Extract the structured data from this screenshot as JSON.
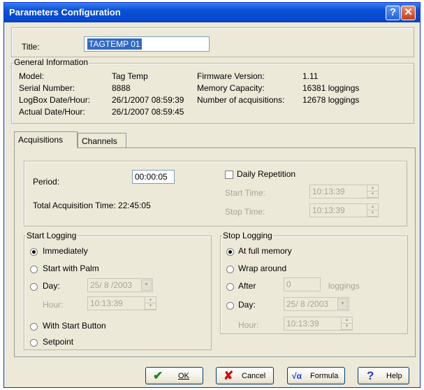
{
  "window": {
    "title": "Parameters Configuration",
    "help_glyph": "?",
    "close_glyph": "✕"
  },
  "title_field": {
    "label": "Title:",
    "value": "TAGTEMP 01"
  },
  "general": {
    "heading": "General Information",
    "left_labels": [
      "Model:",
      "Serial Number:",
      "LogBox Date/Hour:",
      "Actual Date/Hour:"
    ],
    "left_values": [
      "Tag Temp",
      "8888",
      "26/1/2007 08:59:39",
      "26/1/2007 08:59:45"
    ],
    "right_labels": [
      "Firmware Version:",
      "Memory Capacity:",
      "Number of acquisitions:"
    ],
    "right_values": [
      "1.11",
      "16381 loggings",
      "12678 loggings"
    ]
  },
  "tabs": [
    {
      "label": "Acquisitions"
    },
    {
      "label": "Channels"
    }
  ],
  "acq": {
    "period_label": "Period:",
    "period_value": "00:00:05",
    "total_label": "Total Acquisition Time: 22:45:05",
    "daily_label": "Daily Repetition",
    "start_time_label": "Start Time:",
    "start_time_value": "10:13:39",
    "stop_time_label": "Stop Time:",
    "stop_time_value": "10:13:39"
  },
  "start_logging": {
    "heading": "Start Logging",
    "immediately": "Immediately",
    "palm": "Start with Palm",
    "day": "Day:",
    "day_value": "25/ 8 /2003",
    "hour": "Hour:",
    "hour_value": "10:13:39",
    "button": "With Start Button",
    "setpoint": "Setpoint"
  },
  "stop_logging": {
    "heading": "Stop Logging",
    "full": "At full memory",
    "wrap": "Wrap around",
    "after": "After",
    "after_value": "0",
    "loggings": "loggings",
    "day": "Day:",
    "day_value": "25/ 8 /2003",
    "hour": "Hour:",
    "hour_value": "10:13:39"
  },
  "buttons": {
    "ok": "OK",
    "ok_icon": "✔",
    "cancel": "Cancel",
    "cancel_icon": "✘",
    "formula": "Formula",
    "formula_icon": "√α",
    "help": "Help",
    "help_icon": "?"
  },
  "colors": {
    "titlebar": "#0a4fd4",
    "dialog_bg": "#ece9d8",
    "ok_check": "#1a8a1a",
    "cancel_x": "#cc1111",
    "help_q": "#1a3fd0"
  }
}
